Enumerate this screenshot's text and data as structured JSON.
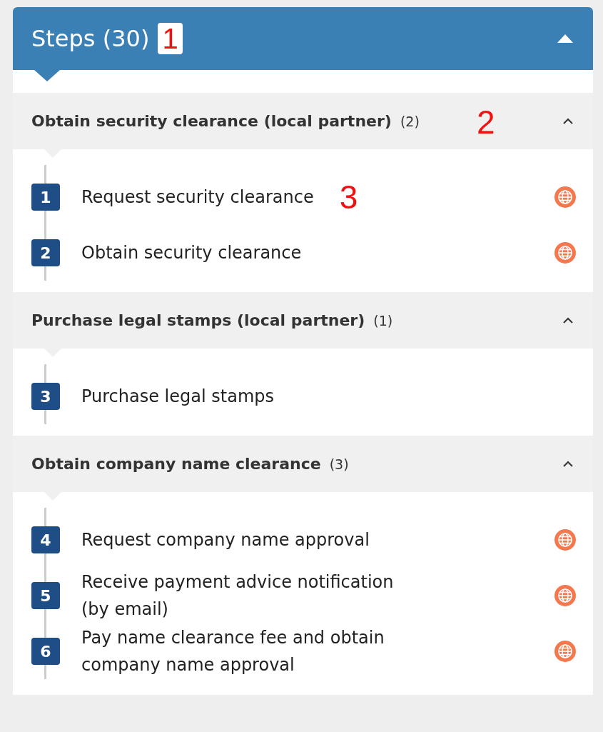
{
  "panel": {
    "title": "Steps (30)",
    "expanded": true,
    "marker": "1"
  },
  "groups": [
    {
      "name": "Obtain security clearance (local partner)",
      "count": "(2)",
      "expanded": true,
      "marker": "2",
      "steps": [
        {
          "number": "1",
          "label": "Request security clearance",
          "online": true,
          "marker": "3"
        },
        {
          "number": "2",
          "label": "Obtain security clearance",
          "online": true
        }
      ]
    },
    {
      "name": "Purchase legal stamps (local partner)",
      "count": "(1)",
      "expanded": true,
      "steps": [
        {
          "number": "3",
          "label": "Purchase legal stamps",
          "online": false
        }
      ]
    },
    {
      "name": "Obtain company name clearance",
      "count": "(3)",
      "expanded": true,
      "steps": [
        {
          "number": "4",
          "label": "Request company name approval",
          "online": true
        },
        {
          "number": "5",
          "label": "Receive payment advice notification (by email)",
          "online": true
        },
        {
          "number": "6",
          "label": "Pay name clearance fee and obtain company name approval",
          "online": true
        }
      ]
    }
  ]
}
